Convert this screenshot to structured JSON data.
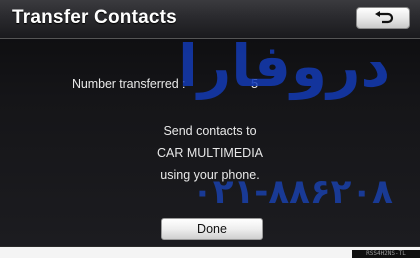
{
  "header": {
    "title": "Transfer Contacts",
    "back_icon": "return-arrow-icon"
  },
  "transfer": {
    "label": "Number transferred :",
    "value": "5"
  },
  "message": {
    "line1": "Send contacts to",
    "line2": "CAR MULTIMEDIA",
    "line3": "using your phone."
  },
  "done_button": {
    "label": "Done"
  },
  "watermark": {
    "line1": "دروفارا",
    "line2": "۰۲۱-۸۸۶۲۰۸"
  },
  "badge_text": "RSS4H2NS-TL",
  "colors": {
    "screen_bg": "#151518",
    "text": "#e8e8e8",
    "watermark": "#143cb9",
    "button_face": "#eeeeee"
  }
}
